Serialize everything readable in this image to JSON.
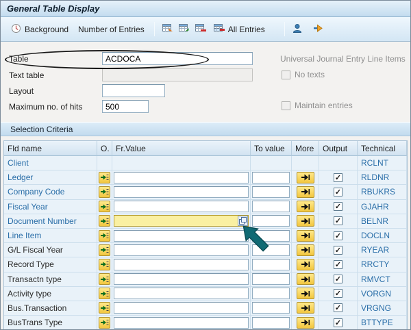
{
  "window": {
    "title": "General Table Display"
  },
  "toolbar": {
    "background": "Background",
    "number_of_entries": "Number of Entries",
    "all_entries": "All Entries"
  },
  "form": {
    "table_label": "Table",
    "table_value": "ACDOCA",
    "right_heading": "Universal Journal Entry Line Items",
    "text_table_label": "Text table",
    "no_texts_label": "No texts",
    "layout_label": "Layout",
    "layout_value": "",
    "max_hits_label": "Maximum no. of hits",
    "max_hits_value": "500",
    "maintain_entries_label": "Maintain entries"
  },
  "selection": {
    "header": "Selection Criteria",
    "columns": {
      "fld": "Fld name",
      "o": "O.",
      "fr": "Fr.Value",
      "to": "To value",
      "more": "More",
      "output": "Output",
      "tech": "Technical"
    },
    "rows": [
      {
        "field": "Client",
        "technical": "RCLNT",
        "key": true,
        "from": "",
        "to": "",
        "output_checked": false,
        "has_controls": false,
        "highlighted": false
      },
      {
        "field": "Ledger",
        "technical": "RLDNR",
        "key": true,
        "from": "",
        "to": "",
        "output_checked": true,
        "has_controls": true,
        "highlighted": false
      },
      {
        "field": "Company Code",
        "technical": "RBUKRS",
        "key": true,
        "from": "",
        "to": "",
        "output_checked": true,
        "has_controls": true,
        "highlighted": false
      },
      {
        "field": "Fiscal Year",
        "technical": "GJAHR",
        "key": true,
        "from": "",
        "to": "",
        "output_checked": true,
        "has_controls": true,
        "highlighted": false
      },
      {
        "field": "Document Number",
        "technical": "BELNR",
        "key": true,
        "from": "",
        "to": "",
        "output_checked": true,
        "has_controls": true,
        "highlighted": true
      },
      {
        "field": "Line Item",
        "technical": "DOCLN",
        "key": true,
        "from": "",
        "to": "",
        "output_checked": true,
        "has_controls": true,
        "highlighted": false
      },
      {
        "field": "G/L Fiscal Year",
        "technical": "RYEAR",
        "key": false,
        "from": "",
        "to": "",
        "output_checked": true,
        "has_controls": true,
        "highlighted": false
      },
      {
        "field": "Record Type",
        "technical": "RRCTY",
        "key": false,
        "from": "",
        "to": "",
        "output_checked": true,
        "has_controls": true,
        "highlighted": false
      },
      {
        "field": "Transactn type",
        "technical": "RMVCT",
        "key": false,
        "from": "",
        "to": "",
        "output_checked": true,
        "has_controls": true,
        "highlighted": false
      },
      {
        "field": "Activity type",
        "technical": "VORGN",
        "key": false,
        "from": "",
        "to": "",
        "output_checked": true,
        "has_controls": true,
        "highlighted": false
      },
      {
        "field": "Bus.Transaction",
        "technical": "VRGNG",
        "key": false,
        "from": "",
        "to": "",
        "output_checked": true,
        "has_controls": true,
        "highlighted": false
      },
      {
        "field": "BusTrans Type",
        "technical": "BTTYPE",
        "key": false,
        "from": "",
        "to": "",
        "output_checked": true,
        "has_controls": true,
        "highlighted": false
      }
    ]
  }
}
